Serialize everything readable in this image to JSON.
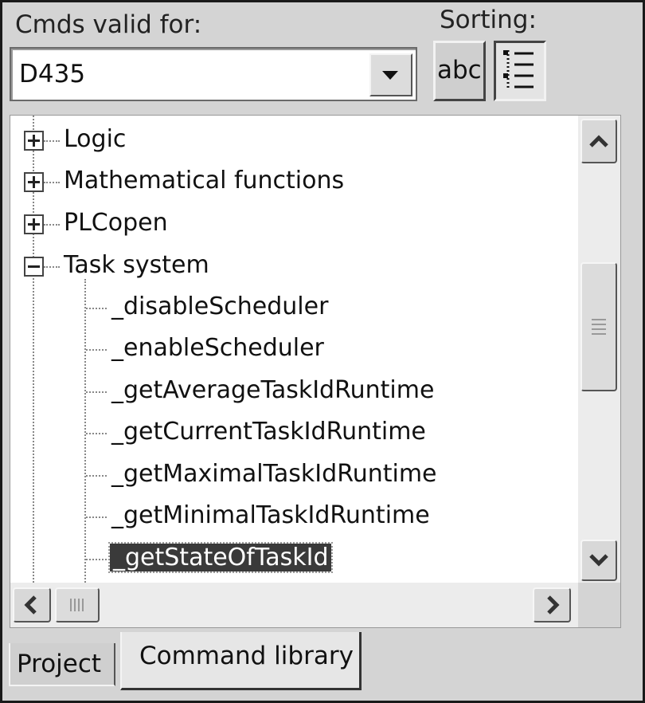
{
  "labels": {
    "cmds_valid_for": "Cmds valid for:",
    "sorting": "Sorting:"
  },
  "device_select": {
    "selected": "D435",
    "dropdown_icon": "chevron-down-icon"
  },
  "sorting_buttons": {
    "alphabetical": {
      "label": "abc",
      "pressed": false
    },
    "categorical": {
      "icon": "category-list-icon",
      "pressed": true
    }
  },
  "tree": {
    "categories": [
      {
        "label": "Logic",
        "expanded": false
      },
      {
        "label": "Mathematical functions",
        "expanded": false
      },
      {
        "label": "PLCopen",
        "expanded": false
      },
      {
        "label": "Task system",
        "expanded": true
      }
    ],
    "task_system_children": [
      "_disableScheduler",
      "_enableScheduler",
      "_getAverageTaskIdRuntime",
      "_getCurrentTaskIdRuntime",
      "_getMaximalTaskIdRuntime",
      "_getMinimalTaskIdRuntime",
      "_getStateOfTaskId"
    ],
    "selected_item": "_getStateOfTaskId"
  },
  "tabs": [
    {
      "label": "Project",
      "active": false
    },
    {
      "label": "Command library",
      "active": true
    }
  ]
}
